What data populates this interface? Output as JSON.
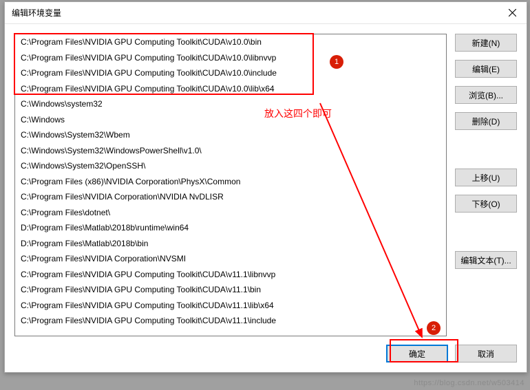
{
  "dialog": {
    "title": "编辑环境变量"
  },
  "listbox": {
    "items": [
      "C:\\Program Files\\NVIDIA GPU Computing Toolkit\\CUDA\\v10.0\\bin",
      "C:\\Program Files\\NVIDIA GPU Computing Toolkit\\CUDA\\v10.0\\libnvvp",
      "C:\\Program Files\\NVIDIA GPU Computing Toolkit\\CUDA\\v10.0\\include",
      "C:\\Program Files\\NVIDIA GPU Computing Toolkit\\CUDA\\v10.0\\lib\\x64",
      "C:\\Windows\\system32",
      "C:\\Windows",
      "C:\\Windows\\System32\\Wbem",
      "C:\\Windows\\System32\\WindowsPowerShell\\v1.0\\",
      "C:\\Windows\\System32\\OpenSSH\\",
      "C:\\Program Files (x86)\\NVIDIA Corporation\\PhysX\\Common",
      "C:\\Program Files\\NVIDIA Corporation\\NVIDIA NvDLISR",
      "C:\\Program Files\\dotnet\\",
      "D:\\Program Files\\Matlab\\2018b\\runtime\\win64",
      "D:\\Program Files\\Matlab\\2018b\\bin",
      "C:\\Program Files\\NVIDIA Corporation\\NVSMI",
      "C:\\Program Files\\NVIDIA GPU Computing Toolkit\\CUDA\\v11.1\\libnvvp",
      "C:\\Program Files\\NVIDIA GPU Computing Toolkit\\CUDA\\v11.1\\bin",
      "C:\\Program Files\\NVIDIA GPU Computing Toolkit\\CUDA\\v11.1\\lib\\x64",
      "C:\\Program Files\\NVIDIA GPU Computing Toolkit\\CUDA\\v11.1\\include"
    ]
  },
  "buttons": {
    "new": "新建(N)",
    "edit": "编辑(E)",
    "browse": "浏览(B)...",
    "delete": "删除(D)",
    "moveup": "上移(U)",
    "movedown": "下移(O)",
    "edittext": "编辑文本(T)...",
    "ok": "确定",
    "cancel": "取消"
  },
  "annotations": {
    "badge1": "1",
    "badge2": "2",
    "note": "放入这四个即可"
  },
  "watermark": "https://blog.csdn.net/w503414"
}
